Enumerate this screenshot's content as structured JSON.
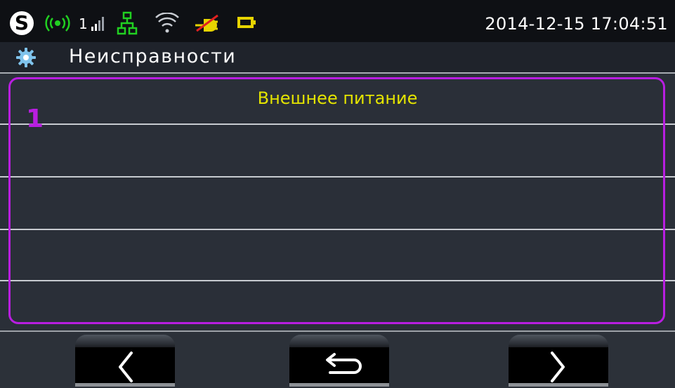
{
  "status_bar": {
    "logo_letter": "S",
    "signal_number": "1",
    "datetime": "2014-12-15 17:04:51",
    "icons": [
      "app-logo-icon",
      "radio-icon",
      "signal-bars-icon",
      "network-icon",
      "wifi-icon",
      "power-disconnected-icon",
      "battery-icon"
    ],
    "colors": {
      "radio": "#21d021",
      "network": "#21d021",
      "power": "#e7d400",
      "power_cross": "#e02020",
      "battery": "#e7d400"
    }
  },
  "title_bar": {
    "icon": "gear-icon",
    "title": "Неисправности"
  },
  "faults": {
    "count": "1",
    "items": [
      {
        "text": "Внешнее питание"
      }
    ],
    "text_color": "#e4e400",
    "accent_color": "#b81ee0"
  },
  "bottom_bar": {
    "buttons": [
      {
        "icon": "chevron-left-icon"
      },
      {
        "icon": "return-icon"
      },
      {
        "icon": "chevron-right-icon"
      }
    ]
  }
}
